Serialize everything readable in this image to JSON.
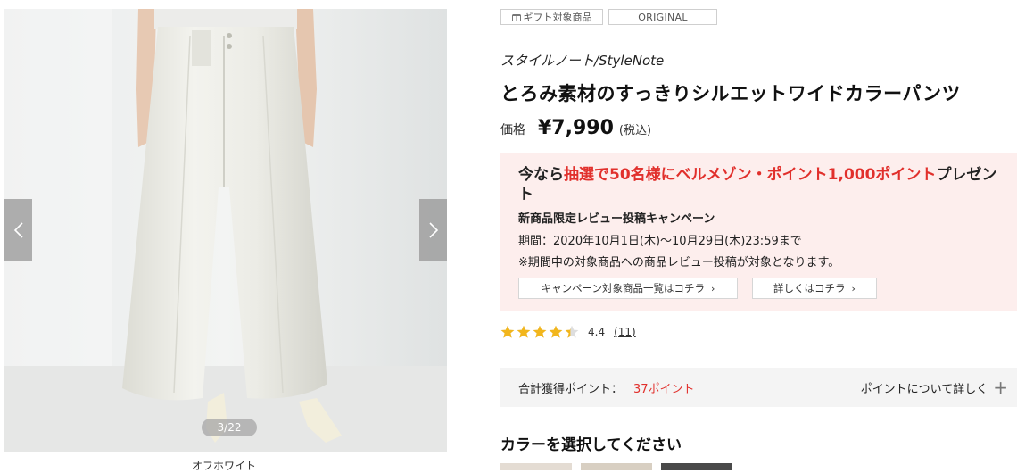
{
  "gallery": {
    "counter": "3/22",
    "caption": "オフホワイト",
    "prev_icon": "chevron-left-icon",
    "next_icon": "chevron-right-icon"
  },
  "tags": {
    "gift": "ギフト対象商品",
    "original": "ORIGINAL"
  },
  "product": {
    "brand": "スタイルノート/StyleNote",
    "title": "とろみ素材のすっきりシルエットワイドカラーパンツ",
    "price_label": "価格",
    "price": "¥7,990",
    "tax": "(税込)"
  },
  "campaign": {
    "head_pre": "今なら",
    "head_red": "抽選で50名様にベルメゾン・ポイント1,000ポイント",
    "head_post": "プレゼント",
    "subtitle": "新商品限定レビュー投稿キャンペーン",
    "period": "期間：2020年10月1日(木)〜10月29日(木)23:59まで",
    "note": "※期間中の対象商品への商品レビュー投稿が対象となります。",
    "link_list": "キャンペーン対象商品一覧はコチラ",
    "link_detail": "詳しくはコチラ",
    "accent_color": "#e1302c",
    "background_color": "#fdeeed"
  },
  "rating": {
    "value": "4.4",
    "stars": 4.4,
    "review_count": "(11)",
    "star_color": "#f2b61c"
  },
  "points": {
    "label": "合計獲得ポイント：",
    "value": "37ポイント",
    "link": "ポイントについて詳しく"
  },
  "color_heading": "カラーを選択してください"
}
